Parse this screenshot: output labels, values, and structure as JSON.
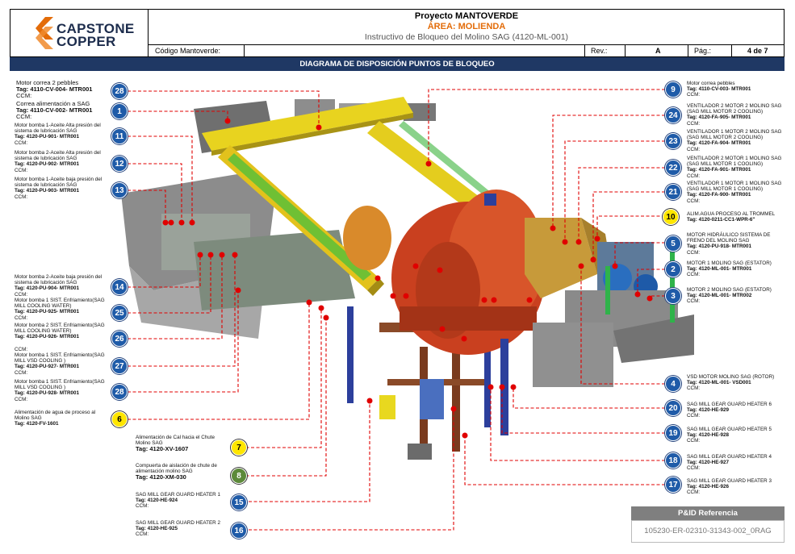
{
  "header": {
    "logo_line1": "CAPSTONE",
    "logo_line2": "COPPER",
    "project": "Proyecto MANTOVERDE",
    "area": "ÁREA: MOLIENDA",
    "instructivo": "Instructivo de Bloqueo del Molino SAG (4120-ML-001)",
    "codigo_label": "Código Mantoverde:",
    "rev_label": "Rev.:",
    "rev_value": "A",
    "pag_label": "Pág.:",
    "pag_value": "4 de 7"
  },
  "banner": "DIAGRAMA DE DISPOSICIÓN PUNTOS DE BLOQUEO",
  "colors": {
    "navy": "#1f3864",
    "orange": "#e36c09",
    "marker_blue": "#1f5ba8",
    "marker_yellow": "#ffe600",
    "marker_green": "#5d8a3a",
    "dash_red": "#e00000"
  },
  "left_labels": [
    {
      "num": "28",
      "line1": "Motor correa 2 pebbles",
      "tag": "Tag: 4110-CV-004- MTR001",
      "ccm": "CCM:"
    },
    {
      "num": "1",
      "line1": "Correa alimentación a SAG",
      "tag": "Tag: 4110-CV-002- MTR001",
      "ccm": "CCM:"
    },
    {
      "num": "11",
      "line1": "Motor bomba 1-Aceite Alta presión del sistema de lubricación SAG",
      "tag": "Tag: 4120-PU-901- MTR001",
      "ccm": "CCM:"
    },
    {
      "num": "12",
      "line1": "Motor bomba 2-Aceite Alta presión del sistema de lubricación SAG",
      "tag": "Tag: 4120-PU-902- MTR001",
      "ccm": "CCM:"
    },
    {
      "num": "13",
      "line1": "Motor bomba 1-Aceite baja presión del sistema de lubricación SAG",
      "tag": "Tag: 4120-PU-903- MTR001",
      "ccm": "CCM:"
    },
    {
      "num": "14",
      "line1": "Motor bomba 2-Aceite baja presión del sistema de lubricación SAG",
      "tag": "Tag: 4120-PU-904- MTR001",
      "ccm": "CCM:"
    },
    {
      "num": "25",
      "line1": "Motor bomba 1 SIST. Enfriamiento(SAG MILL COOLING WATER)",
      "tag": "Tag: 4120-PU-925- MTR001",
      "ccm": "CCM:"
    },
    {
      "num": "26",
      "line1": "Motor bomba 2 SIST. Enfriamiento(SAG MILL COOLING WATER)",
      "tag": "Tag: 4120-PU-926- MTR001",
      "ccm": "CCM:"
    },
    {
      "num": "27",
      "line1": "Motor bomba 1 SIST. Enfriamiento(SAG MILL VSD COOLING )",
      "tag": "Tag: 4120-PU-927- MTR001",
      "ccm": "CCM:"
    },
    {
      "num": "28",
      "line1": "Motor bomba 1 SIST. Enfriamiento(SAG MILL VSD COOLING )",
      "tag": "Tag: 4120-PU-928- MTR001",
      "ccm": "CCM:"
    },
    {
      "num": "6",
      "line1": "Alimentación de agua de proceso al Molino SAG",
      "tag": "Tag: 4120-FV-1601",
      "ccm": ""
    }
  ],
  "bottom_labels": [
    {
      "num": "7",
      "line1": "Alimentación de Cal hacia el Chute Molino SAG",
      "tag": "Tag: 4120-XV-1607",
      "ccm": ""
    },
    {
      "num": "8",
      "line1": "Compuerta de aislación de chute de alimentación molino SAG",
      "tag": "Tag: 4120-XM-030",
      "ccm": ""
    },
    {
      "num": "15",
      "line1": "SAG MILL GEAR GUARD HEATER 1",
      "tag": "Tag: 4120-HE-924",
      "ccm": "CCM:"
    },
    {
      "num": "16",
      "line1": "SAG MILL GEAR GUARD HEATER 2",
      "tag": "Tag: 4120-HE-925",
      "ccm": "CCM:"
    }
  ],
  "right_labels": [
    {
      "num": "9",
      "line1": "Motor correa pebbles",
      "tag": "Tag: 4110-CV-003- MTR001",
      "ccm": "CCM:"
    },
    {
      "num": "24",
      "line1": "VENTILADOR 2 MOTOR 2 MOLINO SAG (SAG MILL MOTOR 2 COOLING)",
      "tag": "Tag: 4120-FA-905- MTR001",
      "ccm": "CCM:"
    },
    {
      "num": "23",
      "line1": "VENTILADOR 1 MOTOR 2 MOLINO SAG (SAG MILL MOTOR 2 COOLING)",
      "tag": "Tag: 4120-FA-904- MTR001",
      "ccm": "CCM:"
    },
    {
      "num": "22",
      "line1": "VENTILADOR 2 MOTOR 1 MOLINO SAG (SAG MILL MOTOR 1 COOLING)",
      "tag": "Tag: 4120-FA-901- MTR001",
      "ccm": "CCM:"
    },
    {
      "num": "21",
      "line1": "VENTILADOR 1 MOTOR 1 MOLINO SAG (SAG MILL MOTOR 1 COOLING)",
      "tag": "Tag: 4120-FA-900- MTR001",
      "ccm": "CCM:"
    },
    {
      "num": "10",
      "line1": "ALIM.AGUA PROCESO AL TROMMEL",
      "tag": "Tag: 4120-0211-CC1-WPR-6\"",
      "ccm": ""
    },
    {
      "num": "5",
      "line1": "MOTOR HIDRÁULICO SISTEMA DE FRENO DEL MOLINO SAG",
      "tag": "Tag: 4120-PU-918- MTR001",
      "ccm": "CCM:"
    },
    {
      "num": "2",
      "line1": "MOTOR 1 MOLINO SAG (ESTATOR)",
      "tag": "Tag: 4120-ML-001- MTR001",
      "ccm": "CCM:"
    },
    {
      "num": "3",
      "line1": "MOTOR 2 MOLINO SAG (ESTATOR)",
      "tag": "Tag: 4120-ML-001- MTR002",
      "ccm": "CCM:"
    },
    {
      "num": "4",
      "line1": "VSD MOTOR MOLINO SAG (ROTOR)",
      "tag": "Tag: 4120-ML-001- VSD001",
      "ccm": "CCM:"
    },
    {
      "num": "20",
      "line1": "SAG MILL GEAR GUARD HEATER 6",
      "tag": "Tag: 4120-HE-929",
      "ccm": "CCM:"
    },
    {
      "num": "19",
      "line1": "SAG MILL GEAR GUARD HEATER 5",
      "tag": "Tag: 4120-HE-928",
      "ccm": "CCM:"
    },
    {
      "num": "18",
      "line1": "SAG MILL GEAR GUARD HEATER 4",
      "tag": "Tag: 4120-HE-927",
      "ccm": "CCM:"
    },
    {
      "num": "17",
      "line1": "SAG MILL GEAR GUARD HEATER 3",
      "tag": "Tag: 4120-HE-926",
      "ccm": "CCM:"
    }
  ],
  "pid": {
    "heading": "P&ID Referencia",
    "value": "105230-ER-02310-31343-002_0RAG"
  }
}
